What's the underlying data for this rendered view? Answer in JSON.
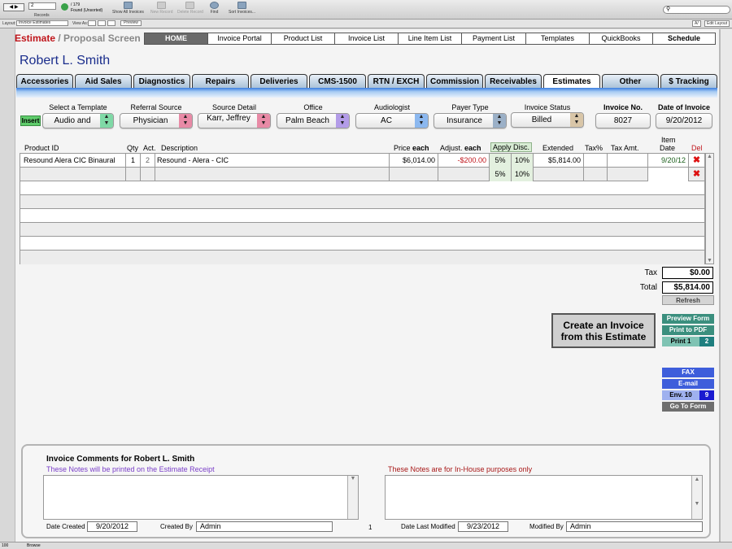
{
  "toolbar": {
    "record_field": "2",
    "record_of": "/ 179",
    "found_status": "Found (Unsorted)",
    "records_label": "Records",
    "show_all": "Show All Invoices",
    "new_record": "New Record",
    "delete_record": "Delete Record",
    "find": "Find",
    "sort": "Sort Invoices...",
    "layout_label": "Layout:",
    "layout_value": "Invoice Estimates",
    "view_as_label": "View As:",
    "preview": "Preview",
    "aa": "A/",
    "edit_layout": "Edit Layout"
  },
  "header": {
    "title_red": "Estimate",
    "title_sep": " / ",
    "title_gray": "Proposal Screen",
    "nav": [
      "HOME",
      "Invoice Portal",
      "Product List",
      "Invoice List",
      "Line Item List",
      "Payment List",
      "Templates",
      "QuickBooks",
      "Schedule"
    ],
    "patient_name": "Robert L. Smith"
  },
  "tabs": [
    "Accessories",
    "Aid Sales",
    "Diagnostics",
    "Repairs",
    "Deliveries",
    "CMS-1500",
    "RTN / EXCH",
    "Commission",
    "Receivables",
    "Estimates",
    "Other",
    "$ Tracking"
  ],
  "fields": {
    "insert": "Insert",
    "template_label": "Select a Template",
    "template_value": "Audio and",
    "referral_label": "Referral Source",
    "referral_value": "Physician",
    "source_label": "Source Detail",
    "source_value": "Karr, Jeffrey",
    "office_label": "Office",
    "office_value": "Palm Beach",
    "audiologist_label": "Audiologist",
    "audiologist_value": "AC",
    "payer_label": "Payer Type",
    "payer_value": "Insurance",
    "status_label": "Invoice Status",
    "status_value": "Billed",
    "invoice_no_label": "Invoice No.",
    "invoice_no_value": "8027",
    "date_label": "Date of Invoice",
    "date_value": "9/20/2012"
  },
  "columns": {
    "product_id": "Product ID",
    "qty": "Qty",
    "act": "Act.",
    "description": "Description",
    "price": "Price",
    "price_bold": "each",
    "adjust": "Adjust.",
    "adjust_bold": "each",
    "apply_disc": "Apply Disc.",
    "extended": "Extended",
    "tax_pct": "Tax%",
    "tax_amt": "Tax Amt.",
    "item_date_1": "Item",
    "item_date_2": "Date",
    "del": "Del"
  },
  "line_items": [
    {
      "product_id": "Resound Alera CIC Binaural",
      "qty": "1",
      "act": "2",
      "description": "Resound - Alera - CIC",
      "price": "$6,014.00",
      "adjust": "-$200.00",
      "disc5": "5%",
      "disc10": "10%",
      "extended": "$5,814.00",
      "tax_pct": "",
      "tax_amt": "",
      "item_date": "9/20/12"
    },
    {
      "product_id": "",
      "qty": "",
      "act": "",
      "description": "",
      "price": "",
      "adjust": "",
      "disc5": "5%",
      "disc10": "10%",
      "extended": "",
      "tax_pct": "",
      "tax_amt": "",
      "item_date": ""
    }
  ],
  "totals": {
    "tax_label": "Tax",
    "tax_value": "$0.00",
    "total_label": "Total",
    "total_value": "$5,814.00",
    "refresh": "Refresh"
  },
  "actions": {
    "create_invoice_1": "Create an Invoice",
    "create_invoice_2": "from this Estimate",
    "preview_form": "Preview Form",
    "print_pdf": "Print to PDF",
    "print1": "Print 1",
    "print1_count": "2",
    "fax": "FAX",
    "email": "E-mail",
    "env10": "Env. 10",
    "env10_count": "9",
    "go_to_form": "Go To Form"
  },
  "comments": {
    "title": "Invoice Comments for Robert L. Smith",
    "receipt_note": "These Notes will be printed on the Estimate Receipt",
    "inhouse_note": "These Notes are for In-House purposes only",
    "date_created_label": "Date Created",
    "date_created": "9/20/2012",
    "created_by_label": "Created By",
    "created_by": "Admin",
    "page_num": "1",
    "date_modified_label": "Date Last Modified",
    "date_modified": "9/23/2012",
    "modified_by_label": "Modified By",
    "modified_by": "Admin"
  },
  "status": {
    "zoom": "100",
    "mode": "Browse"
  },
  "colors": {
    "accent_red": "#c0161c",
    "name_blue": "#1a2d8c",
    "receipt_purple": "#7a3fc8",
    "inhouse_red": "#a81818",
    "button_green": "#3b8f7e",
    "button_blue": "#3e5edb"
  },
  "icons": [
    "search-icon",
    "delete-icon",
    "dropdown-arrow-icon",
    "show-all-icon",
    "new-record-icon",
    "delete-record-icon",
    "find-icon",
    "sort-icon"
  ]
}
